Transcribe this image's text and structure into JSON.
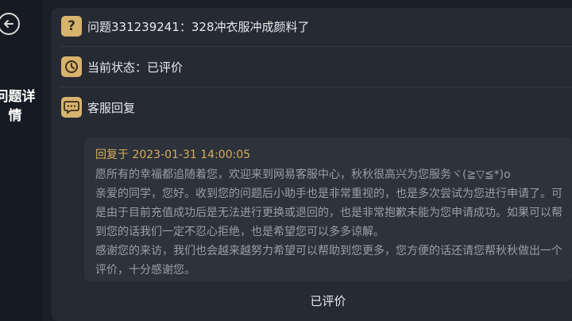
{
  "sidebar": {
    "back_icon": "back-arrow-icon",
    "title": "问题详情",
    "title_line1": "问题详",
    "title_line2": "情"
  },
  "detail": {
    "question": "问题331239241：328冲衣服冲成颜料了",
    "status": "当前状态：已评价",
    "section_label": "客服回复"
  },
  "reply": {
    "header": "回复于 2023-01-31 14:00:05",
    "paragraphs": [
      "愿所有的幸福都追随着您，欢迎来到网易客服中心，秋秋很高兴为您服务ヾ(≧▽≦*)o",
      "亲爱的同学，您好。收到您的问题后小助手也是非常重视的，也是多次尝试为您进行申请了。可是由于目前充值成功后是无法进行更换或退回的，也是非常抱歉未能为您申请成功。如果可以帮到您的话我们一定不忍心拒绝，也是希望您可以多多谅解。",
      "感谢您的来访，我们也会越来越努力希望可以帮助到您更多，您方便的话还请您帮秋秋做出一个评价，十分感谢您。"
    ]
  },
  "footer": {
    "status_label": "已评价"
  },
  "colors": {
    "accent_gold": "#d7b36e",
    "reply_header": "#d7ad5b",
    "background": "#1b1f27",
    "panel": "#252a33"
  },
  "icons": {
    "question": "question-mark-icon",
    "status": "clock-icon",
    "reply": "chat-bubble-icon"
  }
}
